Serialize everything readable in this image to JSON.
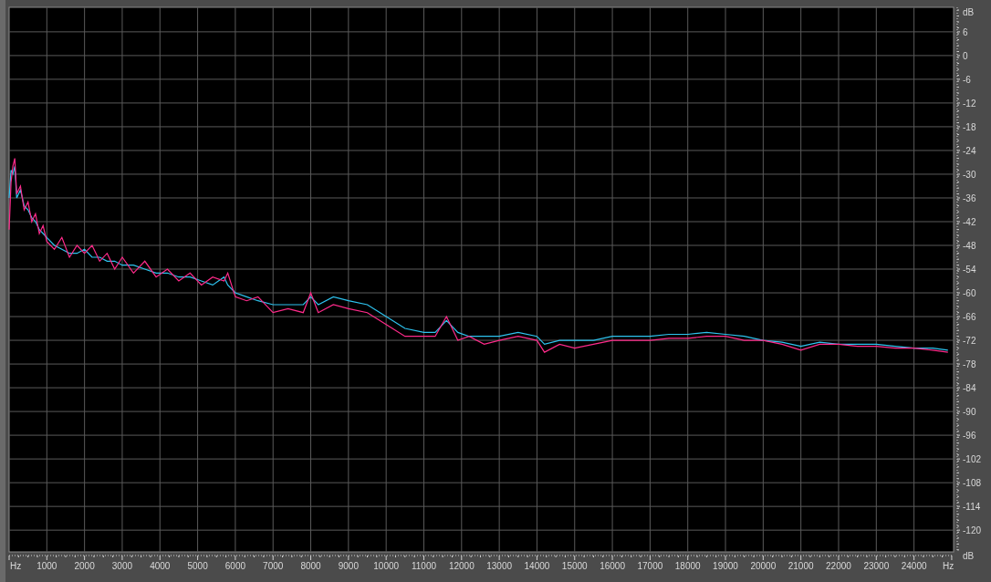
{
  "spectrum": {
    "x_unit_left": "Hz",
    "y_unit_bottom": "dB",
    "chart_data": {
      "type": "line",
      "grid": true,
      "xlabel": "Hz",
      "ylabel": "dB",
      "xlim": [
        0,
        25050
      ],
      "ylim": [
        -125.5,
        12.2
      ],
      "xticks": [
        1000,
        2000,
        3000,
        4000,
        5000,
        6000,
        7000,
        8000,
        9000,
        10000,
        11000,
        12000,
        13000,
        14000,
        15000,
        16000,
        17000,
        18000,
        19000,
        20000,
        21000,
        22000,
        23000,
        24000
      ],
      "yticks": [
        6,
        0,
        -6,
        -12,
        -18,
        -24,
        -30,
        -36,
        -42,
        -48,
        -54,
        -60,
        -66,
        -72,
        -78,
        -84,
        -90,
        -96,
        -102,
        -108,
        -114,
        -120
      ],
      "x": [
        0,
        50,
        100,
        150,
        200,
        300,
        400,
        500,
        600,
        700,
        800,
        900,
        1000,
        1200,
        1400,
        1600,
        1800,
        2000,
        2200,
        2400,
        2600,
        2800,
        3000,
        3300,
        3600,
        3900,
        4200,
        4500,
        4800,
        5100,
        5400,
        5700,
        5800,
        6000,
        6300,
        6600,
        7000,
        7400,
        7800,
        8000,
        8200,
        8600,
        9000,
        9500,
        10000,
        10500,
        11000,
        11300,
        11600,
        11900,
        12200,
        12600,
        13000,
        13500,
        14000,
        14200,
        14600,
        15000,
        15500,
        16000,
        16500,
        17000,
        17500,
        18000,
        18500,
        19000,
        19500,
        20000,
        20500,
        21000,
        21500,
        22000,
        22500,
        23000,
        23500,
        24000,
        24500,
        24900
      ],
      "series": [
        {
          "color": "#2ec4f0",
          "values": [
            -36,
            -29,
            -30,
            -28,
            -36,
            -34,
            -38,
            -39,
            -41,
            -42,
            -44,
            -45,
            -46,
            -48,
            -49,
            -50,
            -50,
            -49,
            -51,
            -51,
            -52,
            -52,
            -53,
            -53,
            -54,
            -55,
            -55,
            -56,
            -56,
            -57,
            -58,
            -56,
            -58,
            -60,
            -61,
            -62,
            -63,
            -63,
            -63,
            -61,
            -63,
            -61,
            -62,
            -63,
            -66,
            -69,
            -70,
            -70,
            -67,
            -70,
            -71,
            -71,
            -71,
            -70,
            -71,
            -73,
            -72,
            -72,
            -72,
            -71,
            -71,
            -71,
            -70.5,
            -70.5,
            -70,
            -70.5,
            -71,
            -72,
            -72.5,
            -73.5,
            -72.5,
            -73,
            -73,
            -73,
            -73.5,
            -74,
            -74,
            -74.5
          ]
        },
        {
          "color": "#ff2a8a",
          "values": [
            -44,
            -32,
            -28,
            -26,
            -35,
            -33,
            -39,
            -37,
            -42,
            -40,
            -45,
            -43,
            -47,
            -49,
            -46,
            -51,
            -48,
            -50,
            -48,
            -52,
            -50,
            -54,
            -51,
            -55,
            -52,
            -56,
            -54,
            -57,
            -55,
            -58,
            -56,
            -57,
            -55,
            -61,
            -62,
            -61,
            -65,
            -64,
            -65,
            -60,
            -65,
            -63,
            -64,
            -65,
            -68,
            -71,
            -71,
            -71,
            -66,
            -72,
            -71,
            -73,
            -72,
            -71,
            -72,
            -75,
            -73,
            -74,
            -73,
            -72,
            -72,
            -72,
            -71.5,
            -71.5,
            -71,
            -71,
            -72,
            -72,
            -73,
            -74.5,
            -73,
            -73,
            -73.5,
            -73.5,
            -74,
            -74,
            -74.5,
            -75
          ]
        }
      ]
    }
  }
}
